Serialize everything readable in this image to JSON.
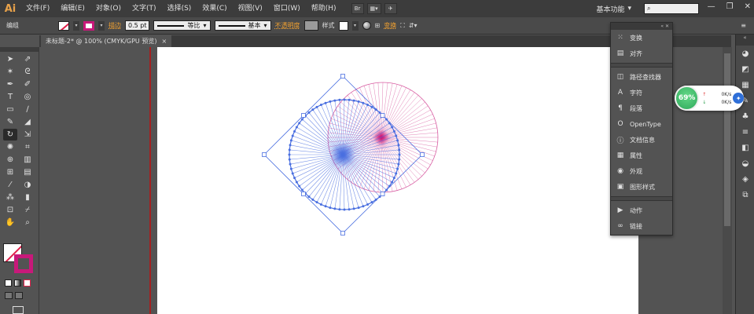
{
  "app": {
    "logo": "Ai"
  },
  "menu": {
    "items": [
      "文件(F)",
      "编辑(E)",
      "对象(O)",
      "文字(T)",
      "选择(S)",
      "效果(C)",
      "视图(V)",
      "窗口(W)",
      "帮助(H)"
    ],
    "bridge_label": "Br",
    "workspace": "基本功能",
    "search_icon": "search-icon"
  },
  "control": {
    "group_label": "编组",
    "stroke_label": "描边",
    "stroke_value": "0.5 pt",
    "profile_label": "等比",
    "brush_label": "基本",
    "opacity_label": "不透明度",
    "style_label": "样式",
    "transform_label": "变换"
  },
  "document": {
    "tab_title": "未标题-2* @ 100% (CMYK/GPU 预览)",
    "close": "×"
  },
  "panel": {
    "items": [
      {
        "label": "变换",
        "icon": "transform-icon",
        "glyph": "⁙"
      },
      {
        "label": "对齐",
        "icon": "align-icon",
        "glyph": "▤"
      },
      {
        "label": "路径查找器",
        "icon": "pathfinder-icon",
        "glyph": "◫"
      },
      {
        "label": "字符",
        "icon": "character-icon",
        "glyph": "A"
      },
      {
        "label": "段落",
        "icon": "paragraph-icon",
        "glyph": "¶"
      },
      {
        "label": "OpenType",
        "icon": "opentype-icon",
        "glyph": "O"
      },
      {
        "label": "文档信息",
        "icon": "document-info-icon",
        "glyph": "ⓘ"
      },
      {
        "label": "属性",
        "icon": "attributes-icon",
        "glyph": "▦"
      },
      {
        "label": "外观",
        "icon": "appearance-icon",
        "glyph": "◉"
      },
      {
        "label": "图形样式",
        "icon": "graphic-styles-icon",
        "glyph": "▣"
      },
      {
        "label": "动作",
        "icon": "actions-icon",
        "glyph": "▶"
      },
      {
        "label": "链接",
        "icon": "links-icon",
        "glyph": "∞"
      }
    ]
  },
  "speed": {
    "percent": "69%",
    "up": "0K/s",
    "down": "0K/s"
  },
  "colors": {
    "accent_pink": "#c8197a",
    "accent_blue": "#4a6fe0",
    "artboard": "#ffffff"
  }
}
